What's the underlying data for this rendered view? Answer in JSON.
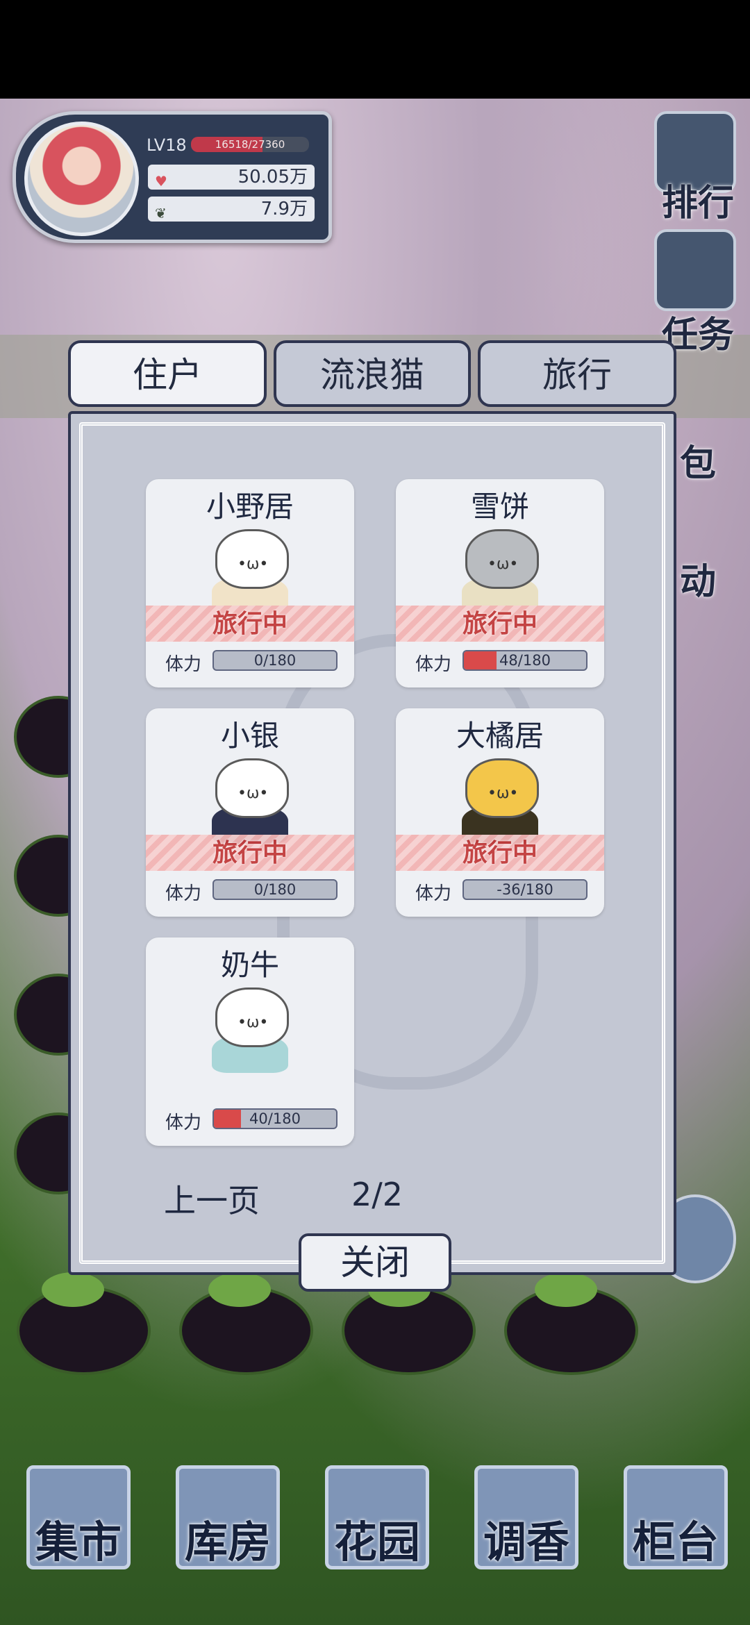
{
  "player": {
    "level": "LV18",
    "xp_text": "16518/27360",
    "xp_fraction": 0.604,
    "coins": "50.05万",
    "seeds": "7.9万",
    "coins_icon": "heart-icon",
    "seeds_icon": "leaf-icon"
  },
  "side_menu": {
    "rank": "排行",
    "tasks": "任务",
    "bag": "包",
    "activity": "动"
  },
  "tabs": [
    {
      "label": "住户",
      "active": true
    },
    {
      "label": "流浪猫",
      "active": false
    },
    {
      "label": "旅行",
      "active": false
    }
  ],
  "travel_text": "旅行中",
  "stat_label": "体力",
  "cats": [
    {
      "name": "小野居",
      "stamina": "0/180",
      "stamina_fraction": 0.0,
      "traveling": true,
      "body_color": "#f1e3c8",
      "head_color": "#ffffff"
    },
    {
      "name": "雪饼",
      "stamina": "48/180",
      "stamina_fraction": 0.267,
      "traveling": true,
      "body_color": "#e9e0c3",
      "head_color": "#b9bcc0"
    },
    {
      "name": "小银",
      "stamina": "0/180",
      "stamina_fraction": 0.0,
      "traveling": true,
      "body_color": "#2d3350",
      "head_color": "#ffffff"
    },
    {
      "name": "大橘居",
      "stamina": "-36/180",
      "stamina_fraction": 0.0,
      "traveling": true,
      "body_color": "#3a3320",
      "head_color": "#f3c64a"
    },
    {
      "name": "奶牛",
      "stamina": "40/180",
      "stamina_fraction": 0.222,
      "traveling": false,
      "body_color": "#a9d6d8",
      "head_color": "#ffffff"
    }
  ],
  "pager": {
    "prev": "上一页",
    "page": "2/2"
  },
  "close_label": "关闭",
  "bottom_nav": [
    "集市",
    "库房",
    "花园",
    "调香",
    "柜台"
  ]
}
